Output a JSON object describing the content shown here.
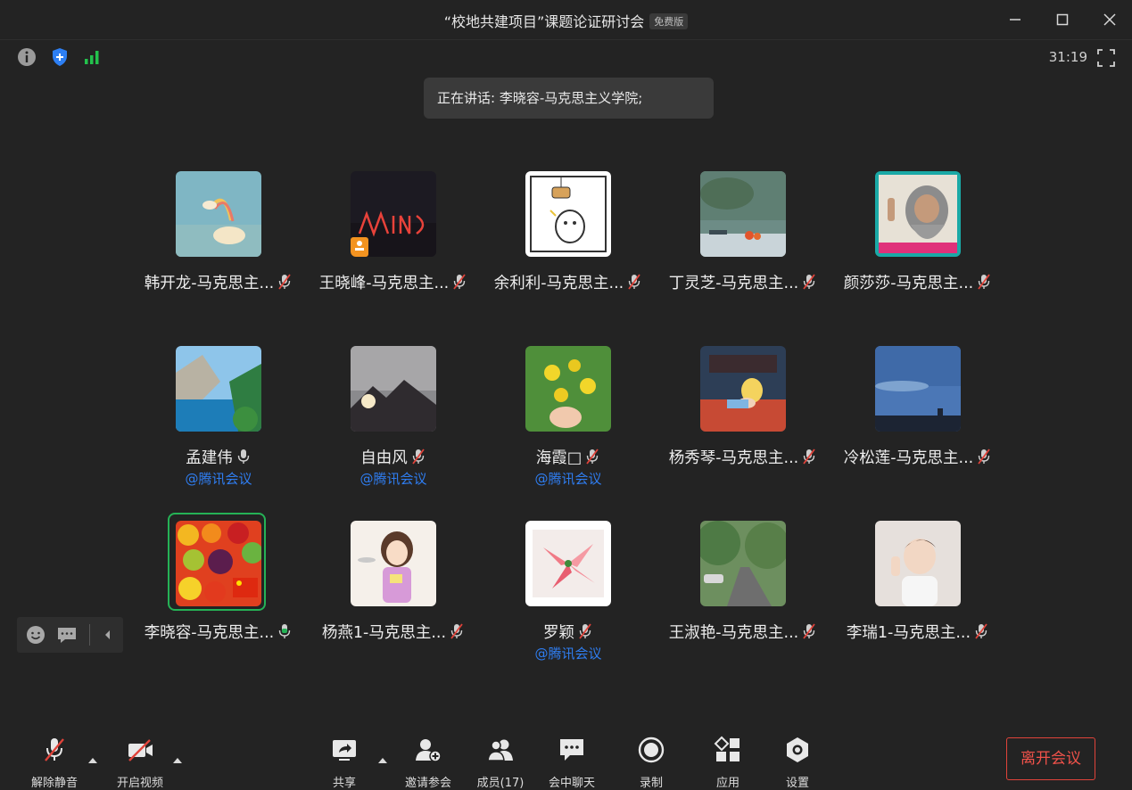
{
  "window": {
    "title": "“校地共建项目”课题论证研讨会",
    "badge": "免费版"
  },
  "status": {
    "timer": "31:19"
  },
  "speaking": "正在讲话: 李晓容-马克思主义学院;",
  "participants": [
    {
      "name": "韩开龙-马克思主...",
      "mic": "muted"
    },
    {
      "name": "王晓峰-马克思主...",
      "mic": "muted"
    },
    {
      "name": "余利利-马克思主...",
      "mic": "muted"
    },
    {
      "name": "丁灵芝-马克思主...",
      "mic": "muted"
    },
    {
      "name": "颜莎莎-马克思主...",
      "mic": "muted"
    },
    {
      "name": "孟建伟",
      "mic": "on",
      "sub": "@腾讯会议"
    },
    {
      "name": "自由风",
      "mic": "muted",
      "sub": "@腾讯会议"
    },
    {
      "name": "海霞□",
      "mic": "muted",
      "sub": "@腾讯会议"
    },
    {
      "name": "杨秀琴-马克思主...",
      "mic": "muted"
    },
    {
      "name": "冷松莲-马克思主...",
      "mic": "muted"
    },
    {
      "name": "李晓容-马克思主...",
      "mic": "speaking",
      "active": true
    },
    {
      "name": "杨燕1-马克思主...",
      "mic": "muted"
    },
    {
      "name": "罗颖",
      "mic": "muted",
      "sub": "@腾讯会议"
    },
    {
      "name": "王淑艳-马克思主...",
      "mic": "muted"
    },
    {
      "name": "李瑞1-马克思主...",
      "mic": "muted"
    }
  ],
  "toolbar": {
    "unmute": "解除静音",
    "video": "开启视频",
    "share": "共享",
    "invite": "邀请参会",
    "members": "成员(17)",
    "chat": "会中聊天",
    "record": "录制",
    "apps": "应用",
    "settings": "设置",
    "leave": "离开会议"
  },
  "colors": {
    "background": "#232323",
    "speaking_green": "#25b256",
    "link_blue": "#2f7df0",
    "leave_red": "#e0433a"
  }
}
